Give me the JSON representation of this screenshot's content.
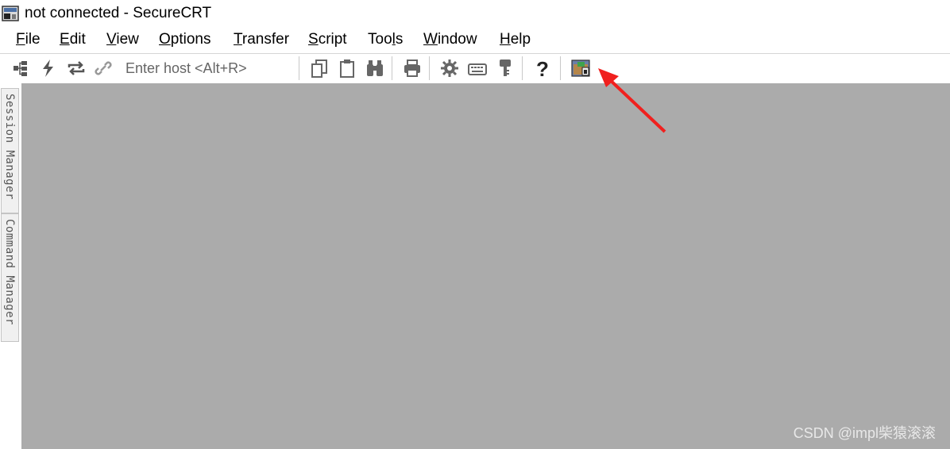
{
  "window": {
    "title": "not connected - SecureCRT"
  },
  "menu": [
    {
      "label": "File",
      "mnemonic": "F",
      "rest": "ile"
    },
    {
      "label": "Edit",
      "mnemonic": "E",
      "rest": "dit"
    },
    {
      "label": "View",
      "mnemonic": "V",
      "rest": "iew"
    },
    {
      "label": "Options",
      "mnemonic": "O",
      "rest": "ptions"
    },
    {
      "label": "Transfer",
      "mnemonic": "T",
      "rest": "ransfer"
    },
    {
      "label": "Script",
      "mnemonic": "S",
      "rest": "cript"
    },
    {
      "label": "Tools",
      "pre": "Too",
      "mnemonic": "l",
      "rest": "s"
    },
    {
      "label": "Window",
      "mnemonic": "W",
      "rest": "indow"
    },
    {
      "label": "Help",
      "mnemonic": "H",
      "rest": "elp"
    }
  ],
  "toolbar": {
    "host_placeholder": "Enter host <Alt+R>",
    "icons": [
      "connect-icon",
      "quick-connect-icon",
      "reconnect-icon",
      "disconnect-icon",
      "copy-icon",
      "paste-icon",
      "find-icon",
      "print-icon",
      "session-options-icon",
      "keymap-icon",
      "key-agent-icon",
      "help-icon",
      "sftp-session-icon"
    ]
  },
  "side_tabs": [
    {
      "label": "Session Manager"
    },
    {
      "label": "Command Manager"
    }
  ],
  "watermark": "CSDN @impl柴猿滚滚",
  "colors": {
    "workspace": "#ababab",
    "annotation_arrow": "#f0201e"
  }
}
